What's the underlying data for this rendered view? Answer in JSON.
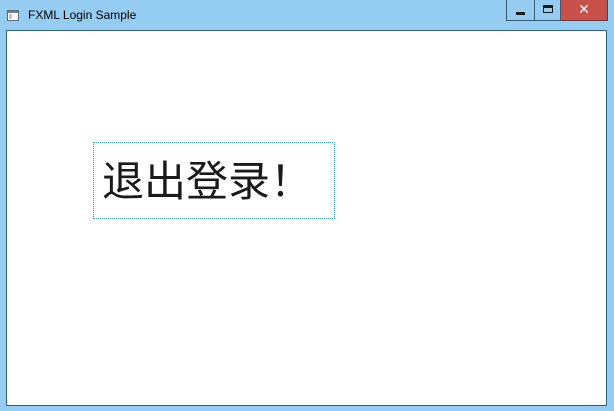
{
  "window": {
    "title": "FXML Login Sample",
    "icon": "app-window-icon",
    "controls": {
      "minimize": "minimize-icon",
      "maximize": "maximize-icon",
      "close": "close-icon",
      "close_glyph": "✕"
    },
    "colors": {
      "titlebar": "#94ccf2",
      "close_button": "#c7504a",
      "focus_border": "#2ea3c8"
    }
  },
  "content": {
    "message": "退出登录！"
  }
}
